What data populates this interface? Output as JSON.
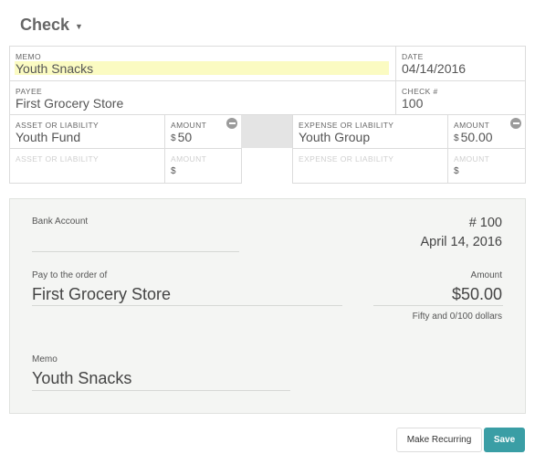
{
  "header": {
    "title": "Check"
  },
  "form": {
    "memo": {
      "label": "MEMO",
      "value": "Youth Snacks"
    },
    "date": {
      "label": "DATE",
      "value": "04/14/2016"
    },
    "payee": {
      "label": "PAYEE",
      "value": "First Grocery Store"
    },
    "check_number": {
      "label": "CHECK #",
      "value": "100"
    },
    "asset_rows": [
      {
        "account_label": "ASSET OR LIABILITY",
        "account_value": "Youth Fund",
        "amount_label": "AMOUNT",
        "currency": "$",
        "amount_value": "50"
      },
      {
        "account_label": "ASSET OR LIABILITY",
        "account_value": "",
        "amount_label": "AMOUNT",
        "currency": "$",
        "amount_value": ""
      }
    ],
    "expense_rows": [
      {
        "account_label": "EXPENSE OR LIABILITY",
        "account_value": "Youth Group",
        "amount_label": "AMOUNT",
        "currency": "$",
        "amount_value": "50.00"
      },
      {
        "account_label": "EXPENSE OR LIABILITY",
        "account_value": "",
        "amount_label": "AMOUNT",
        "currency": "$",
        "amount_value": ""
      }
    ]
  },
  "check_preview": {
    "bank_account_label": "Bank Account",
    "check_number": "# 100",
    "date": "April 14, 2016",
    "pay_to_label": "Pay to the order of",
    "payee": "First Grocery Store",
    "amount_label": "Amount",
    "amount": "$50.00",
    "amount_words": "Fifty and 0/100 dollars",
    "memo_label": "Memo",
    "memo": "Youth Snacks"
  },
  "actions": {
    "make_recurring": "Make Recurring",
    "save": "Save"
  },
  "colors": {
    "accent": "#3a9ea5",
    "highlight": "#fbfbc2"
  }
}
